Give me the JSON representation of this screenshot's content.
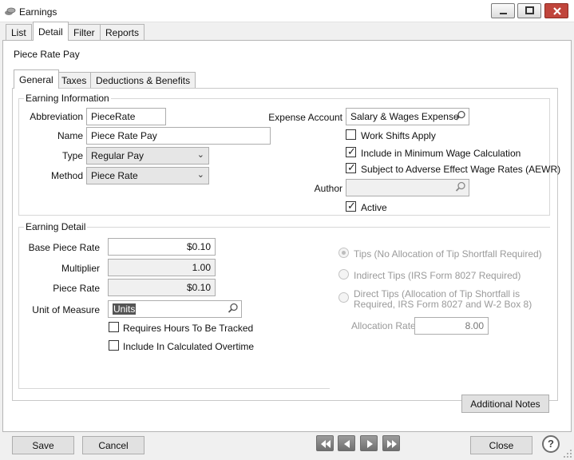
{
  "window": {
    "title": "Earnings",
    "app_icon": "earnings-app-icon",
    "controls": {
      "minimize_icon": "minimize-icon",
      "maximize_icon": "maximize-icon",
      "close_icon": "close-x-icon"
    }
  },
  "top_tabs": [
    {
      "label": "List",
      "active": false
    },
    {
      "label": "Detail",
      "active": true
    },
    {
      "label": "Filter",
      "active": false
    },
    {
      "label": "Reports",
      "active": false
    }
  ],
  "record_title": "Piece Rate Pay",
  "inner_tabs": [
    {
      "label": "General",
      "active": true
    },
    {
      "label": "Taxes",
      "active": false
    },
    {
      "label": "Deductions & Benefits",
      "active": false
    }
  ],
  "earning_information": {
    "legend": "Earning Information",
    "abbreviation": {
      "label": "Abbreviation",
      "value": "PieceRate"
    },
    "name": {
      "label": "Name",
      "value": "Piece Rate Pay"
    },
    "type": {
      "label": "Type",
      "value": "Regular Pay"
    },
    "method": {
      "label": "Method",
      "value": "Piece Rate"
    },
    "expense_account": {
      "label": "Expense Account",
      "value": "Salary & Wages Expense"
    },
    "work_shifts_apply": {
      "label": "Work Shifts Apply",
      "checked": false
    },
    "include_min_wage": {
      "label": "Include in Minimum Wage Calculation",
      "checked": true
    },
    "subject_aewr": {
      "label": "Subject to Adverse Effect Wage Rates (AEWR)",
      "checked": true
    },
    "author": {
      "label": "Author",
      "value": ""
    },
    "active": {
      "label": "Active",
      "checked": true
    }
  },
  "earning_detail": {
    "legend": "Earning Detail",
    "base_piece_rate": {
      "label": "Base Piece Rate",
      "value": "$0.10"
    },
    "multiplier": {
      "label": "Multiplier",
      "value": "1.00"
    },
    "piece_rate": {
      "label": "Piece Rate",
      "value": "$0.10"
    },
    "unit_of_measure": {
      "label": "Unit of Measure",
      "value": "Units"
    },
    "requires_hours": {
      "label": "Requires Hours To Be Tracked",
      "checked": false
    },
    "include_overtime": {
      "label": "Include In Calculated Overtime",
      "checked": false
    },
    "tips_options": [
      {
        "label_1": "Tips (No Allocation of Tip Shortfall Required)",
        "label_2": "",
        "selected": true
      },
      {
        "label_1": "Indirect Tips (IRS Form 8027 Required)",
        "label_2": "",
        "selected": false
      },
      {
        "label_1": "Direct Tips (Allocation of Tip Shortfall is",
        "label_2": "Required, IRS Form 8027 and W-2 Box 8)",
        "selected": false
      }
    ],
    "allocation_rate": {
      "label": "Allocation Rate",
      "value": "8.00"
    }
  },
  "buttons": {
    "additional_notes": "Additional Notes",
    "save": "Save",
    "cancel": "Cancel",
    "close": "Close"
  },
  "nav_icons": [
    "first-record-icon",
    "previous-record-icon",
    "next-record-icon",
    "last-record-icon"
  ],
  "help_icon": "?"
}
